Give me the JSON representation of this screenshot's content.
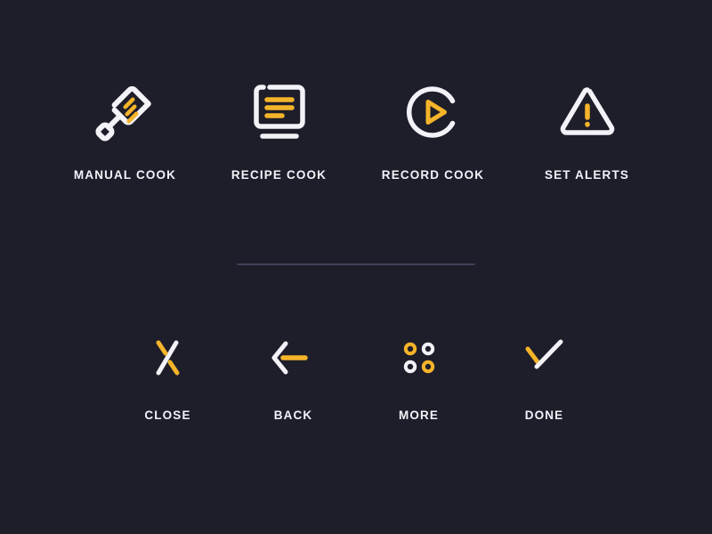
{
  "palette": {
    "background": "#1e1e2b",
    "accent": "#f5b429",
    "stroke_light": "#f2f2f7",
    "divider": "#41415a"
  },
  "primary_row": {
    "items": [
      {
        "label": "MANUAL COOK",
        "icon": "spatula-icon"
      },
      {
        "label": "RECIPE COOK",
        "icon": "recipe-card-icon"
      },
      {
        "label": "RECORD COOK",
        "icon": "play-circle-icon"
      },
      {
        "label": "SET ALERTS",
        "icon": "warning-triangle-icon"
      }
    ]
  },
  "secondary_row": {
    "items": [
      {
        "label": "CLOSE",
        "icon": "close-x-icon"
      },
      {
        "label": "BACK",
        "icon": "arrow-left-icon"
      },
      {
        "label": "MORE",
        "icon": "four-rings-icon"
      },
      {
        "label": "DONE",
        "icon": "checkmark-icon"
      }
    ]
  }
}
